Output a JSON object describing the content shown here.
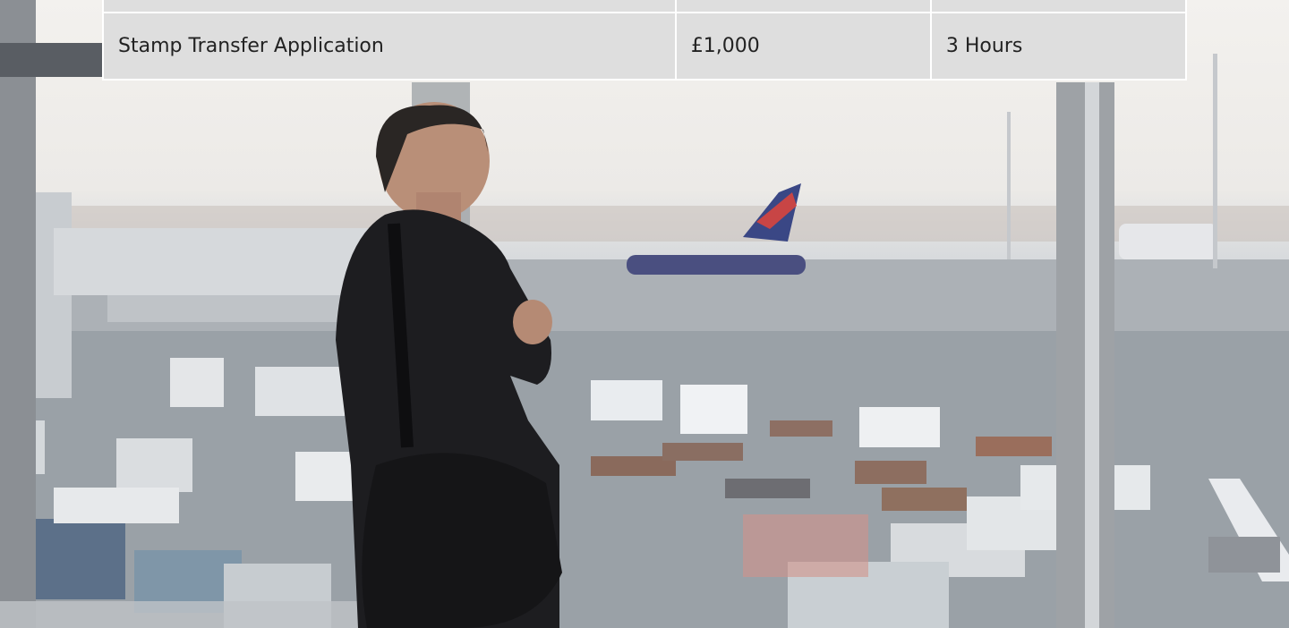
{
  "pricing_table": {
    "rows": [
      {
        "service": "Stamp Transfer Application",
        "price": "£1,000",
        "duration": "3 Hours"
      }
    ]
  },
  "hero_image": {
    "subject": "man-with-shoulder-bag-at-airport-window"
  }
}
